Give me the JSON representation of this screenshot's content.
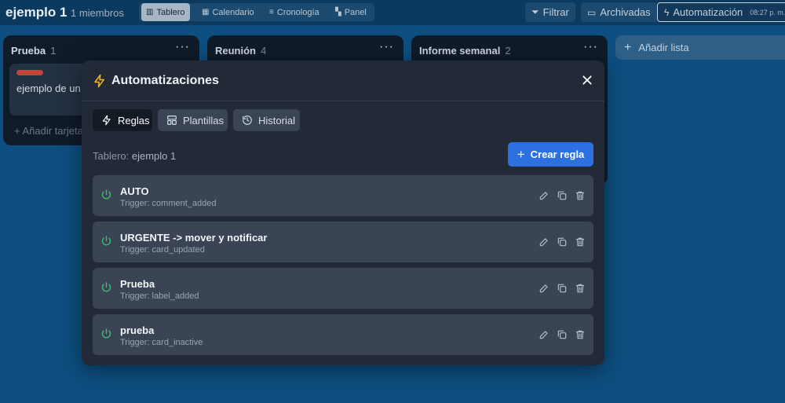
{
  "header": {
    "board_title": "ejemplo 1",
    "members": "1 miembros",
    "views": [
      {
        "label": "Tablero",
        "icon": "board-icon",
        "active": true
      },
      {
        "label": "Calendario",
        "icon": "calendar-icon",
        "active": false
      },
      {
        "label": "Cronología",
        "icon": "timeline-icon",
        "active": false
      },
      {
        "label": "Panel",
        "icon": "dashboard-icon",
        "active": false
      }
    ],
    "filter_label": "Filtrar",
    "archived_label": "Archivadas",
    "automation_label": "Automatización",
    "automation_time": "08:27 p. m."
  },
  "lists": [
    {
      "title": "Prueba",
      "count": "1",
      "card_text": "ejemplo de un d",
      "add_card": "Añadir tarjeta"
    },
    {
      "title": "Reunión",
      "count": "4"
    },
    {
      "title": "Informe semanal",
      "count": "2"
    }
  ],
  "add_list": "Añadir lista",
  "modal": {
    "title": "Automatizaciones",
    "tabs": [
      {
        "label": "Reglas",
        "icon": "bolt-icon",
        "active": true
      },
      {
        "label": "Plantillas",
        "icon": "template-icon",
        "active": false
      },
      {
        "label": "Historial",
        "icon": "history-icon",
        "active": false
      }
    ],
    "board_label": "Tablero:",
    "board_name": "ejemplo 1",
    "create_label": "Crear regla",
    "rules": [
      {
        "name": "AUTO",
        "trigger": "Trigger: comment_added",
        "enabled": true
      },
      {
        "name": "URGENTE -> mover y notificar",
        "trigger": "Trigger: card_updated",
        "enabled": true
      },
      {
        "name": "Prueba",
        "trigger": "Trigger: label_added",
        "enabled": true
      },
      {
        "name": "prueba",
        "trigger": "Trigger: card_inactive",
        "enabled": true
      }
    ]
  },
  "colors": {
    "accent": "#2b6fe0",
    "enabled": "#3fbf6b",
    "label_red": "#c0463c",
    "bolt": "#f0b429"
  }
}
